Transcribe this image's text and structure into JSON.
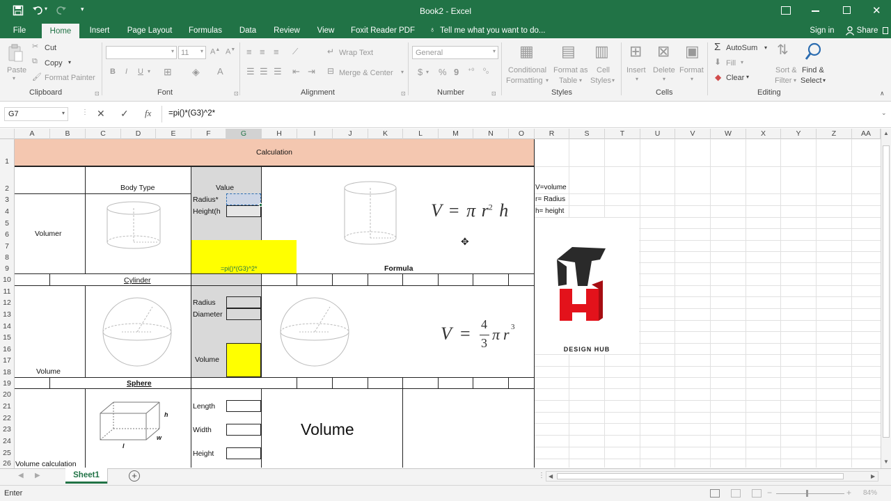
{
  "titlebar": {
    "title": "Book2 - Excel"
  },
  "menu": {
    "file": "File",
    "tabs": [
      "Home",
      "Insert",
      "Page Layout",
      "Formulas",
      "Data",
      "Review",
      "View",
      "Foxit Reader PDF"
    ],
    "tell_me": "Tell me what you want to do...",
    "sign_in": "Sign in",
    "share": "Share"
  },
  "ribbon": {
    "clipboard": {
      "paste": "Paste",
      "cut": "Cut",
      "copy": "Copy",
      "format_painter": "Format Painter",
      "label": "Clipboard"
    },
    "font": {
      "size": "11",
      "bold": "B",
      "italic": "I",
      "underline": "U",
      "label": "Font"
    },
    "alignment": {
      "wrap_text": "Wrap Text",
      "merge_center": "Merge & Center",
      "label": "Alignment"
    },
    "number": {
      "format": "General",
      "currency": "$",
      "percent": "%",
      "comma": "9",
      "label": "Number"
    },
    "styles": {
      "conditional": "Conditional",
      "formatting": "Formatting",
      "format_as": "Format as",
      "table": "Table",
      "cell": "Cell",
      "styles": "Styles",
      "label": "Styles"
    },
    "cells": {
      "insert": "Insert",
      "delete": "Delete",
      "format": "Format",
      "label": "Cells"
    },
    "editing": {
      "autosum": "AutoSum",
      "fill": "Fill",
      "clear": "Clear",
      "sort": "Sort &",
      "filter": "Filter",
      "find": "Find &",
      "select": "Select",
      "label": "Editing"
    }
  },
  "formula_bar": {
    "name_box": "G7",
    "formula": "=pi()*(G3)^2*",
    "fx": "fx"
  },
  "columns": [
    "A",
    "B",
    "C",
    "D",
    "E",
    "F",
    "G",
    "H",
    "I",
    "J",
    "K",
    "L",
    "M",
    "N",
    "O",
    "R",
    "S",
    "T",
    "U",
    "V",
    "W",
    "X",
    "Y",
    "Z",
    "AA"
  ],
  "rows": [
    "1",
    "2",
    "3",
    "4",
    "5",
    "6",
    "7",
    "8",
    "9",
    "10",
    "11",
    "12",
    "13",
    "14",
    "15",
    "16",
    "17",
    "18",
    "19",
    "20",
    "21",
    "22",
    "23",
    "24",
    "25",
    "26"
  ],
  "sheet": {
    "title": "Calculation",
    "body_type": "Body Type",
    "value": "Value",
    "volumer": "Volumer",
    "radius_a": "Radius*",
    "height_a": "Height(h",
    "formula_text": "=pi()*(G3)^2*",
    "formula_label": "Formula",
    "cylinder": "Cylinder",
    "radius": "Radius",
    "diameter": "Diameter",
    "volume_lbl": "Volume",
    "volume_a": "Volume",
    "sphere": "Sphere",
    "length": "Length",
    "width": "Width",
    "height": "Height",
    "volume_big": "Volume",
    "volume_calc": "Volume calculation",
    "legend_v": "V=volume",
    "legend_r": "r= Radius",
    "legend_h": "h= height",
    "logo_text": "DESIGN HUB",
    "eq1": {
      "v": "V",
      "eq": "=",
      "pi": "π",
      "r": "r",
      "exp": "2",
      "h": "h"
    },
    "eq2": {
      "v": "V",
      "eq": "=",
      "num": "4",
      "den": "3",
      "pi": "π",
      "r": "r",
      "exp": "3"
    },
    "box_l": "l",
    "box_w": "w",
    "box_h": "h"
  },
  "tabs": {
    "sheet1": "Sheet1"
  },
  "status": {
    "mode": "Enter",
    "zoom": "84%"
  },
  "colors": {
    "excel_green": "#217346",
    "header_fill": "#f4c7b0",
    "highlight": "#ffff00",
    "gray_fill": "#d9d9d9"
  }
}
